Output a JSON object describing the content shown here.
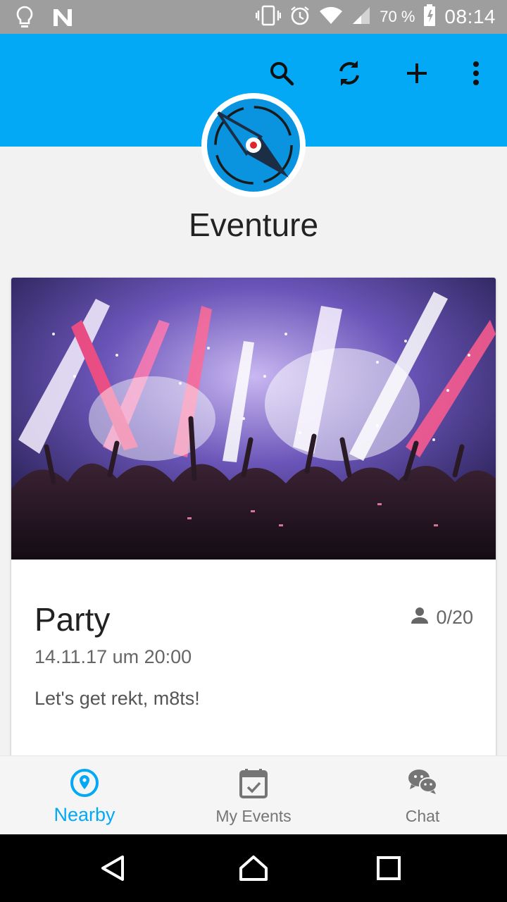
{
  "status_bar": {
    "battery_text": "70 %",
    "time": "08:14",
    "icons": [
      "lightbulb-icon",
      "n-logo-icon",
      "vibrate-icon",
      "alarm-icon",
      "wifi-icon",
      "signal-icon",
      "battery-icon"
    ]
  },
  "toolbar": {
    "color": "#03a9f4",
    "actions": [
      "search-icon",
      "sync-icon",
      "add-icon",
      "more-vert-icon"
    ]
  },
  "header": {
    "app_title": "Eventure",
    "logo_icon": "compass-icon"
  },
  "event_card": {
    "image": "concert-crowd-image",
    "title": "Party",
    "participants": "0/20",
    "participants_icon": "person-icon",
    "date": "14.11.17 um 20:00",
    "description": "Let's get rekt, m8ts!"
  },
  "bottom_nav": {
    "active_color": "#03a9f4",
    "items": [
      {
        "label": "Nearby",
        "icon": "location-pin-icon",
        "active": true
      },
      {
        "label": "My Events",
        "icon": "calendar-check-icon",
        "active": false
      },
      {
        "label": "Chat",
        "icon": "chat-bubbles-icon",
        "active": false
      }
    ]
  },
  "system_nav": {
    "buttons": [
      "back-icon",
      "home-icon",
      "recents-icon"
    ]
  }
}
